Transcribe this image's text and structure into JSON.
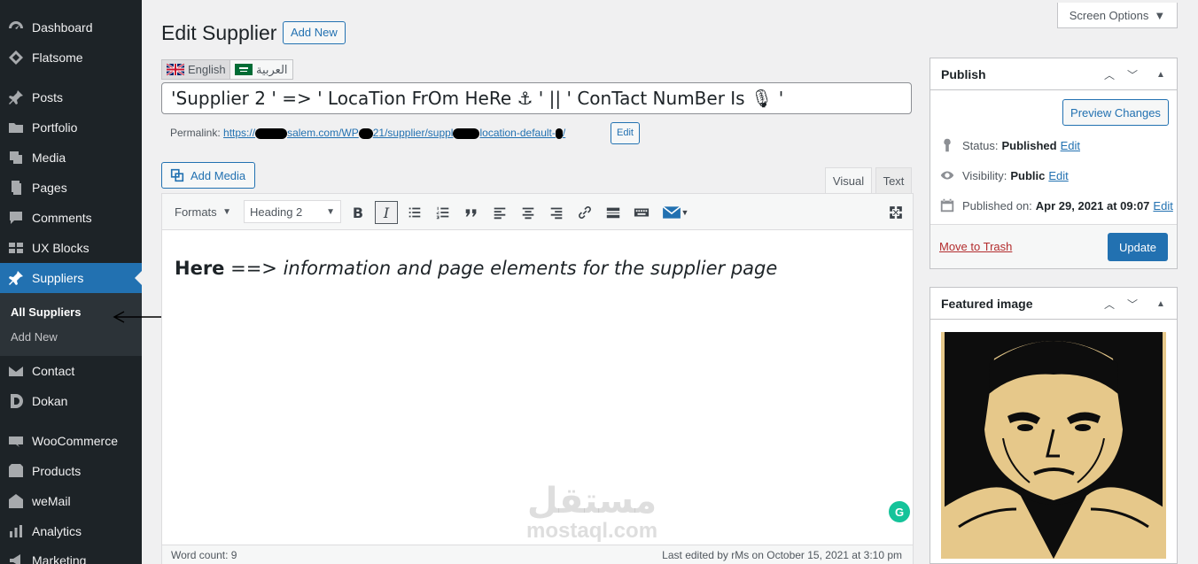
{
  "sidebar": {
    "items": [
      {
        "label": "Dashboard",
        "icon": "dashboard-icon"
      },
      {
        "label": "Flatsome",
        "icon": "flatsome-icon"
      },
      {
        "label": "Posts",
        "icon": "pin-icon"
      },
      {
        "label": "Portfolio",
        "icon": "folder-icon"
      },
      {
        "label": "Media",
        "icon": "media-icon"
      },
      {
        "label": "Pages",
        "icon": "pages-icon"
      },
      {
        "label": "Comments",
        "icon": "comment-icon"
      },
      {
        "label": "UX Blocks",
        "icon": "grid-icon"
      },
      {
        "label": "Suppliers",
        "icon": "pin-icon"
      },
      {
        "label": "Contact",
        "icon": "mail-icon"
      },
      {
        "label": "Dokan",
        "icon": "dokan-icon"
      },
      {
        "label": "WooCommerce",
        "icon": "woo-icon"
      },
      {
        "label": "Products",
        "icon": "box-icon"
      },
      {
        "label": "weMail",
        "icon": "envelope-icon"
      },
      {
        "label": "Analytics",
        "icon": "chart-icon"
      },
      {
        "label": "Marketing",
        "icon": "megaphone-icon"
      }
    ],
    "submenu": [
      "All Suppliers",
      "Add New"
    ]
  },
  "header": {
    "title": "Edit Supplier",
    "add_new": "Add New",
    "screen_options": "Screen Options"
  },
  "languages": {
    "english": "English",
    "arabic": "العربية"
  },
  "post": {
    "title": "'Supplier 2 ' => ' LocaTion FrOm HeRe ⚓ ' || ' ConTact NumBer Is 🎙 '",
    "permalink_label": "Permalink:",
    "permalink_parts": [
      "https://",
      "salem.com/WP",
      "21/supplier/suppl",
      "location-default-",
      "/"
    ],
    "permalink_edit": "Edit"
  },
  "editor": {
    "add_media": "Add Media",
    "tab_visual": "Visual",
    "tab_text": "Text",
    "formats": "Formats",
    "heading": "Heading 2",
    "content_bold": "Here",
    "content_arrow": " ==> ",
    "content_italic": "information and page elements for the supplier page",
    "word_count": "Word count: 9",
    "last_edited": "Last edited by rMs on October 15, 2021 at 3:10 pm"
  },
  "publish": {
    "title": "Publish",
    "preview": "Preview Changes",
    "status_label": "Status:",
    "status_value": "Published",
    "visibility_label": "Visibility:",
    "visibility_value": "Public",
    "published_label": "Published on:",
    "published_value": "Apr 29, 2021 at 09:07",
    "edit": "Edit",
    "trash": "Move to Trash",
    "update": "Update"
  },
  "featured": {
    "title": "Featured image"
  },
  "watermark": {
    "arabic": "مستقل",
    "latin": "mostaql.com"
  },
  "colors": {
    "sidebar_bg": "#1d2327",
    "accent": "#2271b1",
    "trash": "#b32d2e"
  }
}
